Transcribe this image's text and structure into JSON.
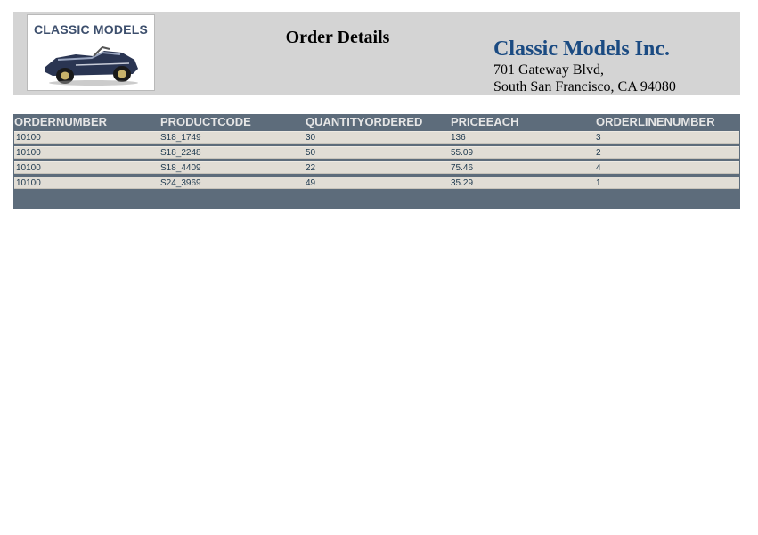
{
  "header": {
    "logo_text": "CLASSIC MODELS",
    "title": "Order Details",
    "company": {
      "name": "Classic Models Inc.",
      "address_line1": "701 Gateway Blvd,",
      "address_line2": "South San Francisco, CA 94080"
    }
  },
  "table": {
    "columns": [
      "ORDERNUMBER",
      "PRODUCTCODE",
      "QUANTITYORDERED",
      "PRICEEACH",
      "ORDERLINENUMBER"
    ],
    "rows": [
      [
        "10100",
        "S18_1749",
        "30",
        "136",
        "3"
      ],
      [
        "10100",
        "S18_2248",
        "50",
        "55.09",
        "2"
      ],
      [
        "10100",
        "S18_4409",
        "22",
        "75.46",
        "4"
      ],
      [
        "10100",
        "S24_3969",
        "49",
        "35.29",
        "1"
      ]
    ]
  },
  "colors": {
    "header_band": "#d4d4d4",
    "table_frame": "#5d6c7b",
    "row_background": "#e1ddd5",
    "company_name": "#1b4b82"
  }
}
